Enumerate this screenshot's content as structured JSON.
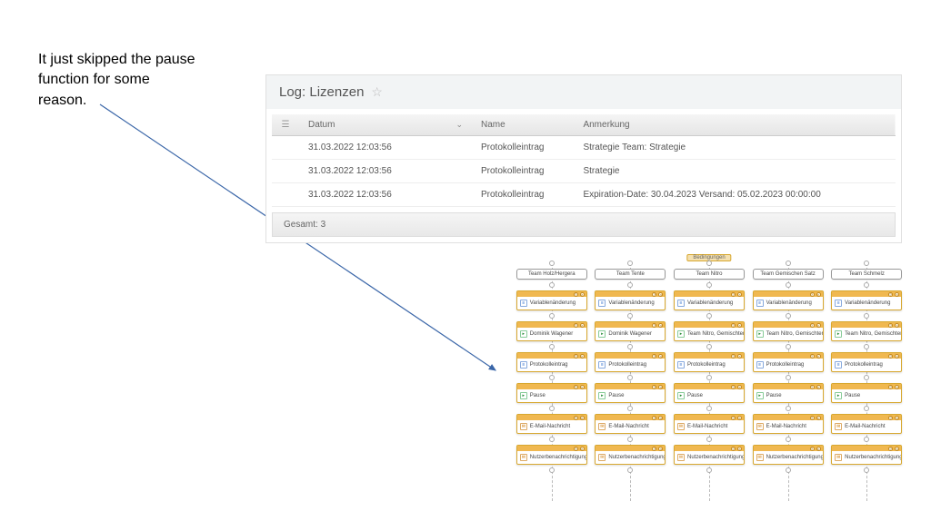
{
  "annotation": "It just skipped the pause function for some reason.",
  "log": {
    "title": "Log: Lizenzen",
    "columns": {
      "datum": "Datum",
      "name": "Name",
      "anmerkung": "Anmerkung"
    },
    "rows": [
      {
        "datum": "31.03.2022 12:03:56",
        "name": "Protokolleintrag",
        "anmerkung": "Strategie Team: Strategie"
      },
      {
        "datum": "31.03.2022 12:03:56",
        "name": "Protokolleintrag",
        "anmerkung": "Strategie"
      },
      {
        "datum": "31.03.2022 12:03:56",
        "name": "Protokolleintrag",
        "anmerkung": "Expiration-Date: 30.04.2023 Versand: 05.02.2023 00:00:00"
      }
    ],
    "footer": "Gesamt: 3"
  },
  "workflow": {
    "top_label": "Bedingungen",
    "columns": [
      {
        "team": "Team Holz/Hergera",
        "nodes": [
          {
            "icon": "blue",
            "label": "Variablenänderung"
          },
          {
            "icon": "green",
            "label": "Dominik Wagener"
          },
          {
            "icon": "blue",
            "label": "Protokolleintrag"
          },
          {
            "icon": "green",
            "label": "Pause"
          },
          {
            "icon": "orange",
            "label": "E-Mail-Nachricht"
          },
          {
            "icon": "orange",
            "label": "Nutzerbenachrichtigung"
          }
        ]
      },
      {
        "team": "Team Tente",
        "nodes": [
          {
            "icon": "blue",
            "label": "Variablenänderung"
          },
          {
            "icon": "green",
            "label": "Dominik Wagener"
          },
          {
            "icon": "blue",
            "label": "Protokolleintrag"
          },
          {
            "icon": "green",
            "label": "Pause"
          },
          {
            "icon": "orange",
            "label": "E-Mail-Nachricht"
          },
          {
            "icon": "orange",
            "label": "Nutzerbenachrichtigung"
          }
        ]
      },
      {
        "team": "Team Nitro",
        "nodes": [
          {
            "icon": "blue",
            "label": "Variablenänderung"
          },
          {
            "icon": "green",
            "label": "Team Nitro, Gemischter Satz"
          },
          {
            "icon": "blue",
            "label": "Protokolleintrag"
          },
          {
            "icon": "green",
            "label": "Pause"
          },
          {
            "icon": "orange",
            "label": "E-Mail-Nachricht"
          },
          {
            "icon": "orange",
            "label": "Nutzerbenachrichtigung"
          }
        ]
      },
      {
        "team": "Team Gemischen Satz",
        "nodes": [
          {
            "icon": "blue",
            "label": "Variablenänderung"
          },
          {
            "icon": "green",
            "label": "Team Nitro, Gemischter Satz"
          },
          {
            "icon": "blue",
            "label": "Protokolleintrag"
          },
          {
            "icon": "green",
            "label": "Pause"
          },
          {
            "icon": "orange",
            "label": "E-Mail-Nachricht"
          },
          {
            "icon": "orange",
            "label": "Nutzerbenachrichtigung"
          }
        ]
      },
      {
        "team": "Team Schmelz",
        "nodes": [
          {
            "icon": "blue",
            "label": "Variablenänderung"
          },
          {
            "icon": "green",
            "label": "Team Nitro, Gemischter Satz"
          },
          {
            "icon": "blue",
            "label": "Protokolleintrag"
          },
          {
            "icon": "green",
            "label": "Pause"
          },
          {
            "icon": "orange",
            "label": "E-Mail-Nachricht"
          },
          {
            "icon": "orange",
            "label": "Nutzerbenachrichtigung"
          }
        ]
      }
    ]
  }
}
